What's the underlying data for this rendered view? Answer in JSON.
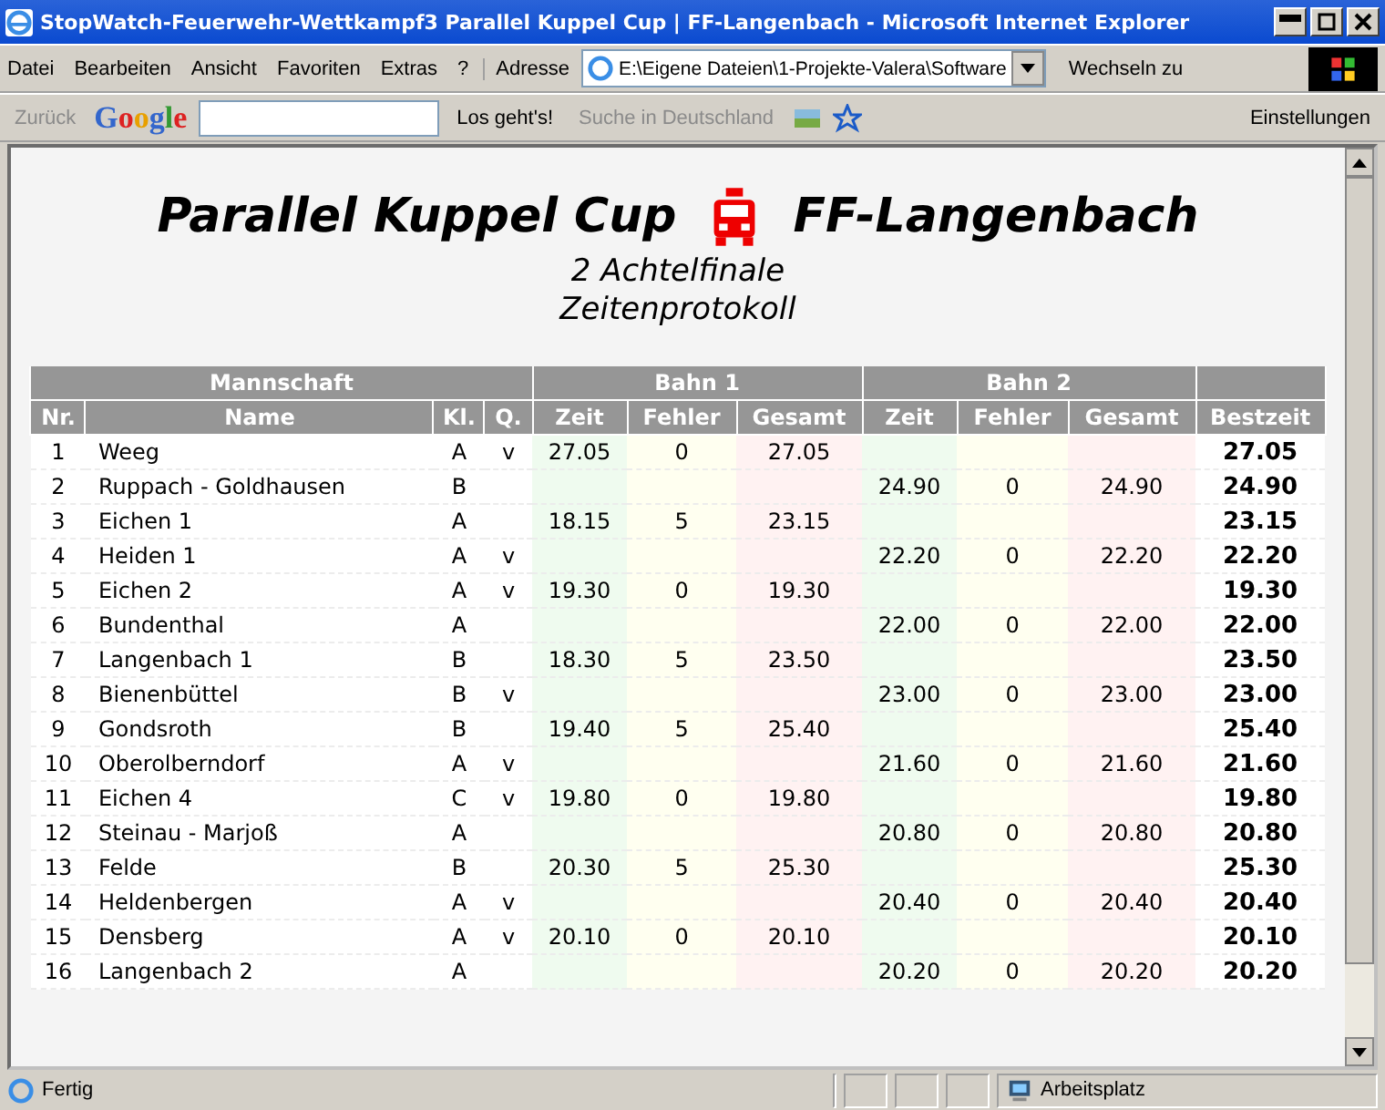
{
  "window": {
    "title": "StopWatch-Feuerwehr-Wettkampf3 Parallel Kuppel Cup | FF-Langenbach - Microsoft Internet Explorer"
  },
  "menu": [
    "Datei",
    "Bearbeiten",
    "Ansicht",
    "Favoriten",
    "Extras",
    "?"
  ],
  "address": {
    "label": "Adresse",
    "value": "E:\\Eigene Dateien\\1-Projekte-Valera\\Software",
    "go": "Wechseln zu"
  },
  "toolbar": {
    "back": "Zurück",
    "logo": "Google",
    "search_button": "Los geht's!",
    "search_in": "Suche in Deutschland",
    "settings": "Einstellungen"
  },
  "page": {
    "title_left": "Parallel Kuppel Cup",
    "title_right": "FF-Langenbach",
    "subtitle": "2 Achtelfinale",
    "subtitle2": "Zeitenprotokoll"
  },
  "table": {
    "groups": [
      "Mannschaft",
      "Bahn 1",
      "Bahn 2"
    ],
    "columns": [
      "Nr.",
      "Name",
      "Kl.",
      "Q.",
      "Zeit",
      "Fehler",
      "Gesamt",
      "Zeit",
      "Fehler",
      "Gesamt",
      "Bestzeit"
    ],
    "rows": [
      {
        "nr": "1",
        "name": "Weeg",
        "class": "A",
        "q": "v",
        "lane1": [
          "27.05",
          "0",
          "27.05"
        ],
        "best": "27.05"
      },
      {
        "nr": "2",
        "name": "Ruppach - Goldhausen",
        "class": "B",
        "lane2": [
          "24.90",
          "0",
          "24.90"
        ],
        "best": "24.90"
      },
      {
        "nr": "3",
        "name": "Eichen 1",
        "class": "A",
        "lane1": [
          "18.15",
          "5",
          "23.15"
        ],
        "best": "23.15"
      },
      {
        "nr": "4",
        "name": "Heiden 1",
        "class": "A",
        "q": "v",
        "lane2": [
          "22.20",
          "0",
          "22.20"
        ],
        "best": "22.20"
      },
      {
        "nr": "5",
        "name": "Eichen 2",
        "class": "A",
        "q": "v",
        "lane1": [
          "19.30",
          "0",
          "19.30"
        ],
        "best": "19.30"
      },
      {
        "nr": "6",
        "name": "Bundenthal",
        "class": "A",
        "lane2": [
          "22.00",
          "0",
          "22.00"
        ],
        "best": "22.00"
      },
      {
        "nr": "7",
        "name": "Langenbach 1",
        "class": "B",
        "lane1": [
          "18.30",
          "5",
          "23.50"
        ],
        "best": "23.50"
      },
      {
        "nr": "8",
        "name": "Bienenbüttel",
        "class": "B",
        "q": "v",
        "lane2": [
          "23.00",
          "0",
          "23.00"
        ],
        "best": "23.00"
      },
      {
        "nr": "9",
        "name": "Gondsroth",
        "class": "B",
        "lane1": [
          "19.40",
          "5",
          "25.40"
        ],
        "best": "25.40"
      },
      {
        "nr": "10",
        "name": "Oberolberndorf",
        "class": "A",
        "q": "v",
        "lane2": [
          "21.60",
          "0",
          "21.60"
        ],
        "best": "21.60"
      },
      {
        "nr": "11",
        "name": "Eichen 4",
        "class": "C",
        "q": "v",
        "lane1": [
          "19.80",
          "0",
          "19.80"
        ],
        "best": "19.80"
      },
      {
        "nr": "12",
        "name": "Steinau - Marjoß",
        "class": "A",
        "lane2": [
          "20.80",
          "0",
          "20.80"
        ],
        "best": "20.80"
      },
      {
        "nr": "13",
        "name": "Felde",
        "class": "B",
        "lane1": [
          "20.30",
          "5",
          "25.30"
        ],
        "best": "25.30"
      },
      {
        "nr": "14",
        "name": "Heldenbergen",
        "class": "A",
        "q": "v",
        "lane2": [
          "20.40",
          "0",
          "20.40"
        ],
        "best": "20.40"
      },
      {
        "nr": "15",
        "name": "Densberg",
        "class": "A",
        "q": "v",
        "lane1": [
          "20.10",
          "0",
          "20.10"
        ],
        "best": "20.10"
      },
      {
        "nr": "16",
        "name": "Langenbach 2",
        "class": "A",
        "lane2": [
          "20.20",
          "0",
          "20.20"
        ],
        "best": "20.20"
      }
    ]
  },
  "status_bar": {
    "text": "Fertig",
    "zone": "Arbeitsplatz"
  }
}
